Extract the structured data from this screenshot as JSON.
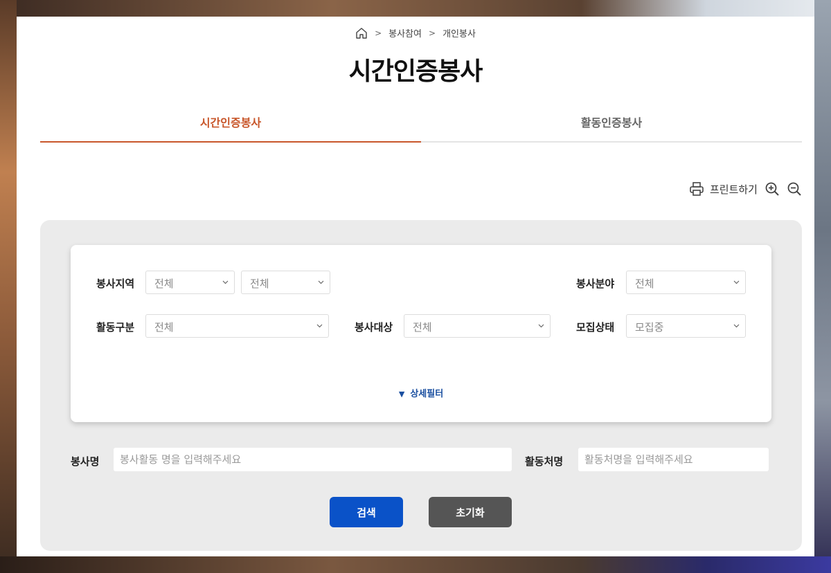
{
  "breadcrumb": {
    "items": [
      "봉사참여",
      "개인봉사"
    ]
  },
  "page_title": "시간인증봉사",
  "tabs": [
    {
      "label": "시간인증봉사",
      "active": true
    },
    {
      "label": "활동인증봉사",
      "active": false
    }
  ],
  "toolbar": {
    "print_label": "프린트하기"
  },
  "filters": {
    "region_label": "봉사지역",
    "region_sido": "전체",
    "region_sigungu": "전체",
    "field_label": "봉사분야",
    "field_value": "전체",
    "activity_label": "활동구분",
    "activity_value": "전체",
    "target_label": "봉사대상",
    "target_value": "전체",
    "status_label": "모집상태",
    "status_value": "모집중",
    "detail_label": "상세필터"
  },
  "search": {
    "name_label": "봉사명",
    "name_placeholder": "봉사활동 명을 입력해주세요",
    "place_label": "활동처명",
    "place_placeholder": "활동처명을 입력해주세요",
    "search_button": "검색",
    "reset_button": "초기화"
  },
  "colors": {
    "accent": "#c8562a",
    "primary_button": "#0a52c8",
    "secondary_button": "#555555",
    "link": "#1a4fa0"
  }
}
